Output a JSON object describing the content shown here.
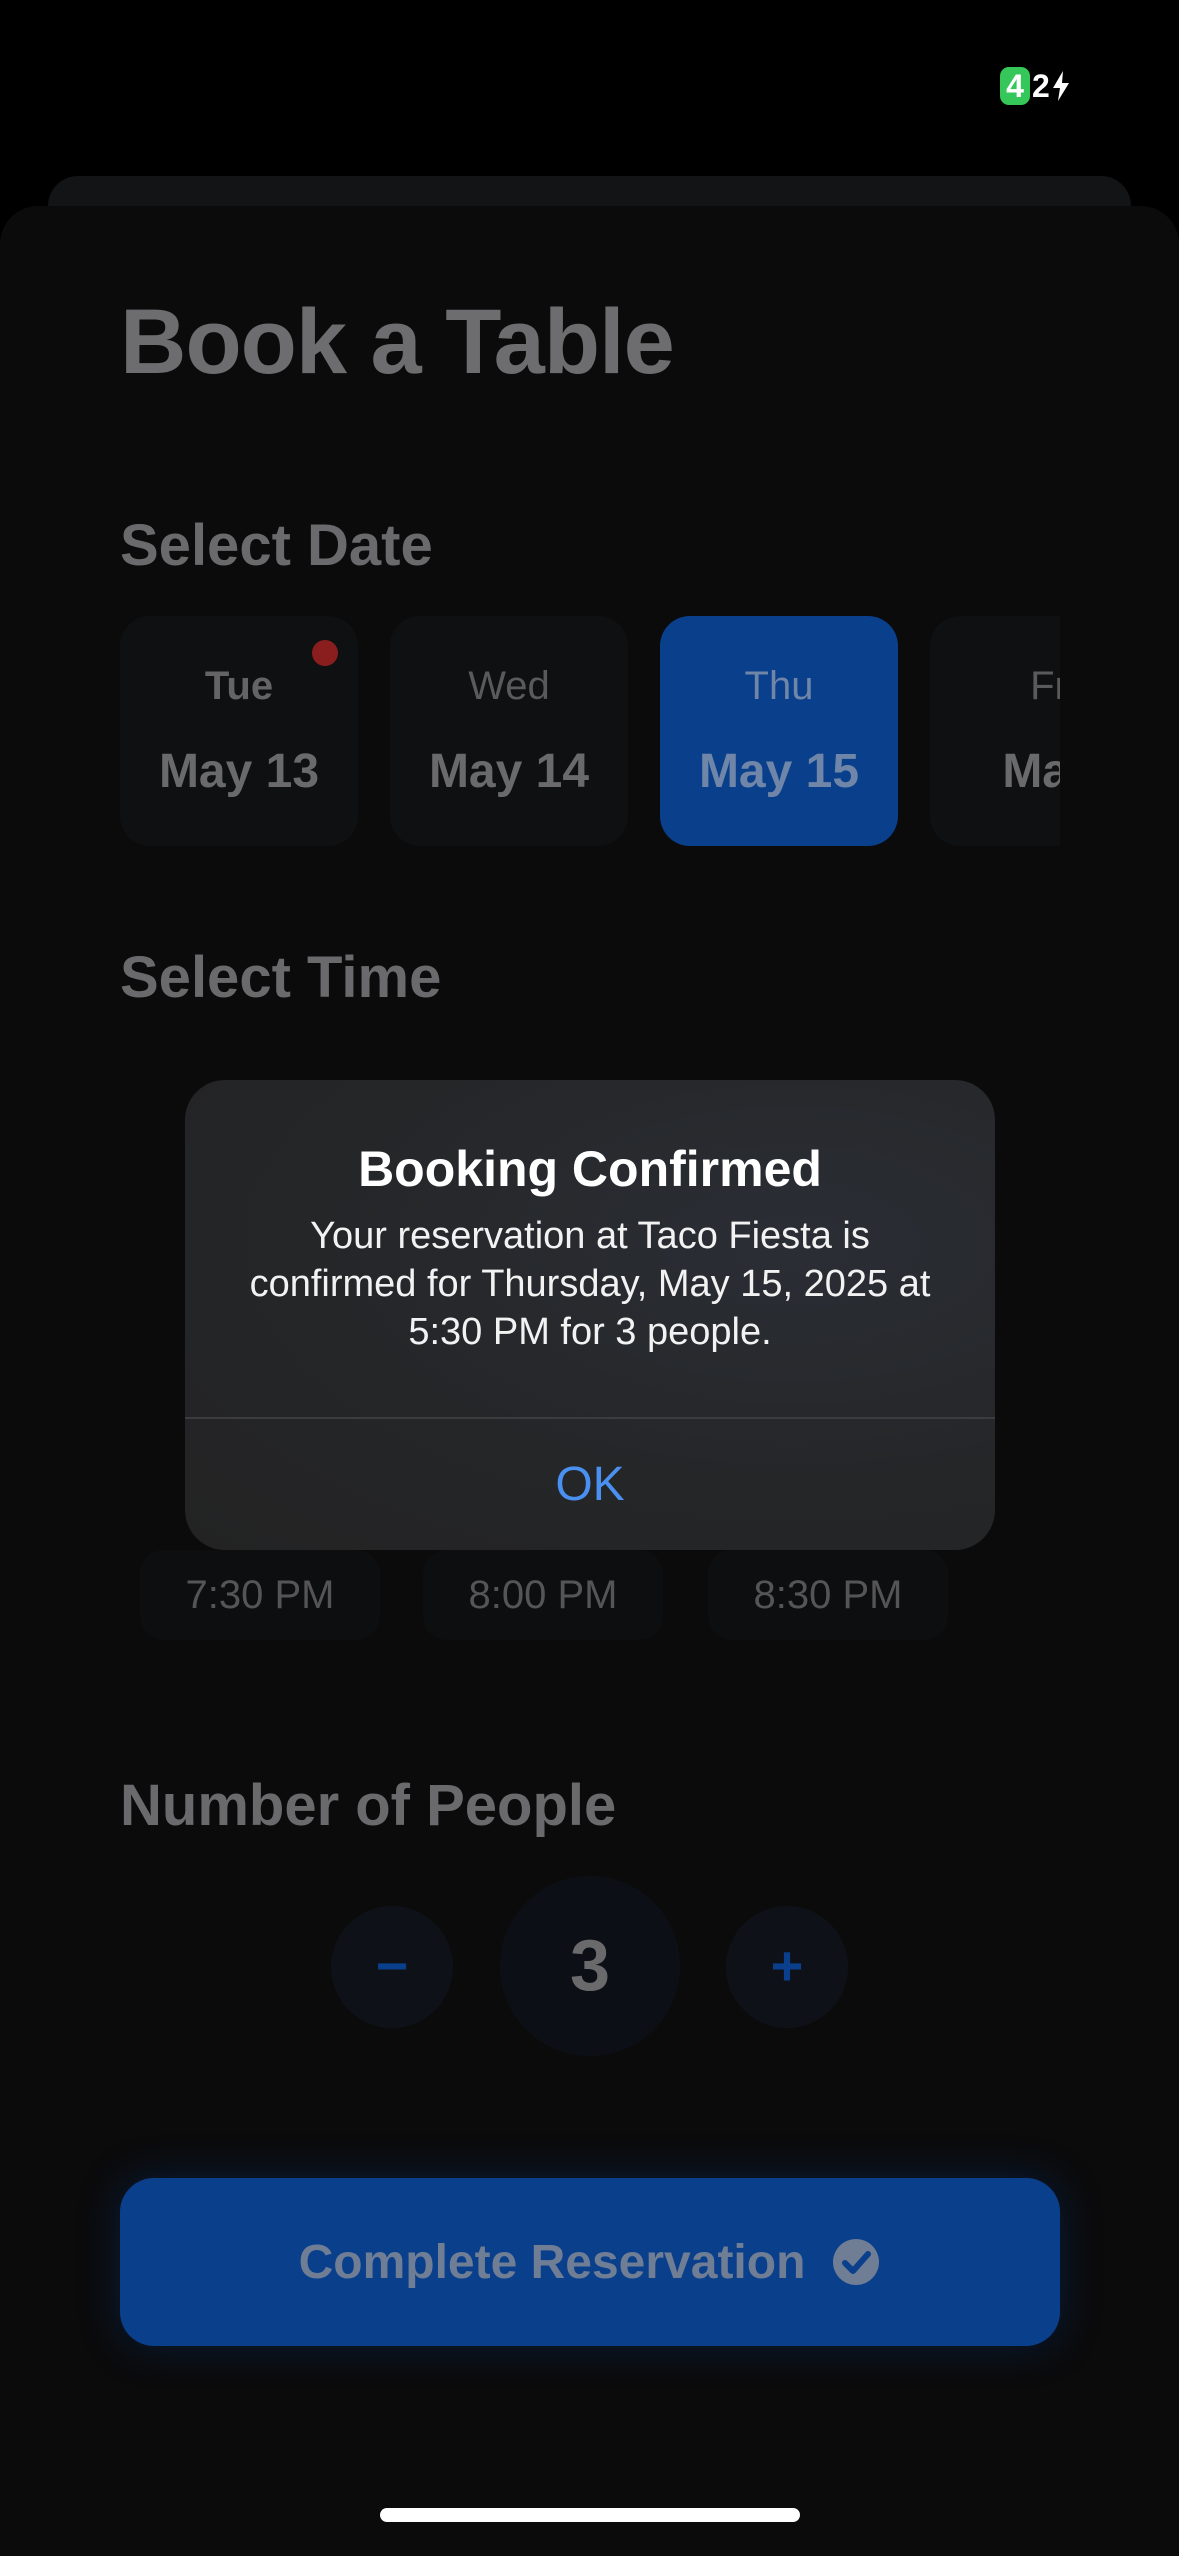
{
  "status_bar": {
    "battery_level_box": "4",
    "battery_level_rest": "2"
  },
  "page": {
    "title": "Book a Table"
  },
  "date_section": {
    "title": "Select Date",
    "dates": [
      {
        "day": "Tue",
        "date": "May 13"
      },
      {
        "day": "Wed",
        "date": "May 14"
      },
      {
        "day": "Thu",
        "date": "May 15"
      },
      {
        "day": "Fr",
        "date": "May"
      }
    ]
  },
  "time_section": {
    "title": "Select Time",
    "visible_slots": [
      "7:30 PM",
      "8:00 PM",
      "8:30 PM"
    ]
  },
  "people_section": {
    "title": "Number of People",
    "count": "3",
    "decrement_label": "−",
    "increment_label": "+"
  },
  "complete_button": {
    "label": "Complete Reservation"
  },
  "alert": {
    "title": "Booking Confirmed",
    "message": "Your reservation at Taco Fiesta is confirmed for Thursday, May 15, 2025 at 5:30 PM for 3 people.",
    "ok_label": "OK"
  },
  "colors": {
    "accent_blue": "#0a3f8c",
    "alert_button_blue": "#4a90f0",
    "battery_green": "#35c759",
    "notification_red": "#8a1e1e"
  }
}
